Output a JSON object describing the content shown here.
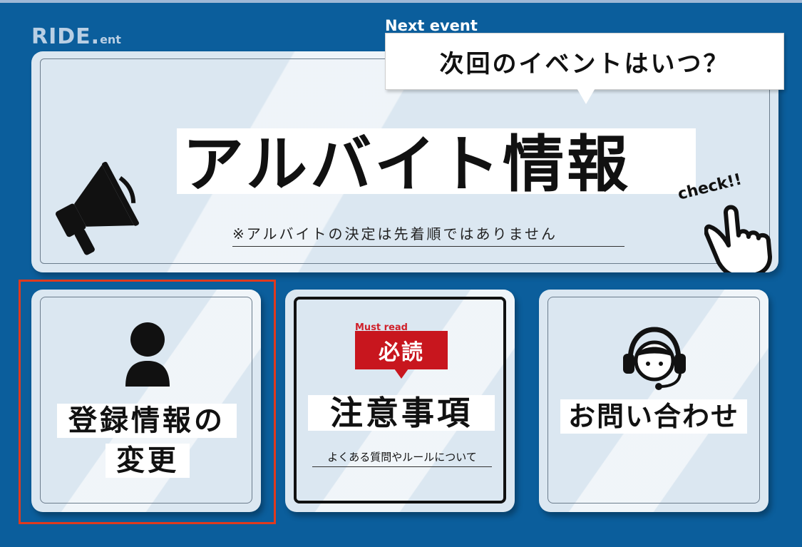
{
  "brand": {
    "logo_main": "RIDE.",
    "logo_suffix": "ent"
  },
  "banner": {
    "next_event_label": "Next event",
    "bubble_text": "次回のイベントはいつ？",
    "headline": "アルバイト情報",
    "note": "※アルバイトの決定は先着順ではありません",
    "check_text": "check!!"
  },
  "cards": {
    "registration": {
      "label_line1": "登録情報の",
      "label_line2": "変更"
    },
    "notes": {
      "badge_small": "Must read",
      "badge": "必読",
      "title": "注意事項",
      "subtitle": "よくある質問やルールについて"
    },
    "contact": {
      "label": "お問い合わせ"
    }
  },
  "colors": {
    "background": "#0b5e9c",
    "card": "#dbe7f1",
    "badge_red": "#c8161e",
    "selection": "#e03a1e"
  }
}
